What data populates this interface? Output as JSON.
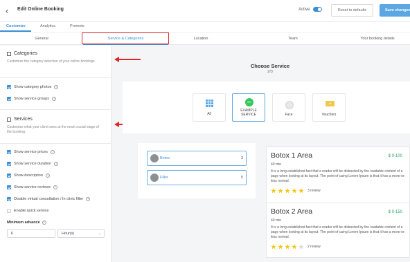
{
  "header": {
    "back_icon": "back-chevron-icon",
    "title": "Edit Online Booking",
    "active_label": "Active",
    "reset_label": "Reset to defaults",
    "save_label": "Save changes"
  },
  "tabs": [
    "Customize",
    "Analytics",
    "Promote"
  ],
  "subtabs": [
    "General",
    "Service & Categories",
    "Location",
    "Team",
    "Your booking details"
  ],
  "sidebar": {
    "categories_title": "Categories",
    "categories_desc": "Customize the category selection of your online bookings.",
    "category_options": [
      {
        "label": "Show category photos",
        "checked": true
      },
      {
        "label": "Show service groups",
        "checked": true
      }
    ],
    "services_title": "Services",
    "services_desc": "Customize what your client sees at the most crucial stage of the booking.",
    "service_options": [
      {
        "label": "Show service prices",
        "checked": true
      },
      {
        "label": "Show service duration",
        "checked": true
      },
      {
        "label": "Show description",
        "checked": true
      },
      {
        "label": "Show service reviews",
        "checked": true
      },
      {
        "label": "Disable virtual consultation / In clinic filter",
        "checked": true
      },
      {
        "label": "Enable quick service",
        "checked": false
      }
    ],
    "min_advance_label": "Minimum advance",
    "min_advance_value": "6",
    "min_advance_unit": "Hour(s)"
  },
  "main": {
    "title": "Choose Service",
    "step": "2/3",
    "categories": [
      {
        "label": "All",
        "icon": "grid-icon"
      },
      {
        "label": "EXAMPLE SERVICE",
        "badge": "ES",
        "icon": "example-service-icon"
      },
      {
        "label": "Face",
        "icon": "face-icon"
      },
      {
        "label": "Vouchers",
        "icon": "voucher-icon"
      }
    ],
    "services": [
      {
        "name": "Botox",
        "count": "3"
      },
      {
        "name": "Filler",
        "count": "5"
      }
    ],
    "cards": [
      {
        "title": "Botox 1 Area",
        "price": "$ 0-100",
        "duration": "40 min",
        "description": "It is a long established fact that a reader will be distracted by the readable content of a page when looking at its layout. The point of using Lorem Ipsum is that it has a more-or-less normal.",
        "rating": 5,
        "reviews": "3 review"
      },
      {
        "title": "Botox 2 Area",
        "price": "$ 0-150",
        "duration": "40 min",
        "description": "It is a long established fact that a reader will be distracted by the readable content of a page when looking at its layout. The point of using Lorem Ipsum is that it has a more-or-less normal.",
        "rating": 4,
        "reviews": "2 review"
      }
    ]
  },
  "colors": {
    "accent": "#3b8fd6",
    "price": "#2ca36b",
    "highlight": "#e0262b"
  }
}
